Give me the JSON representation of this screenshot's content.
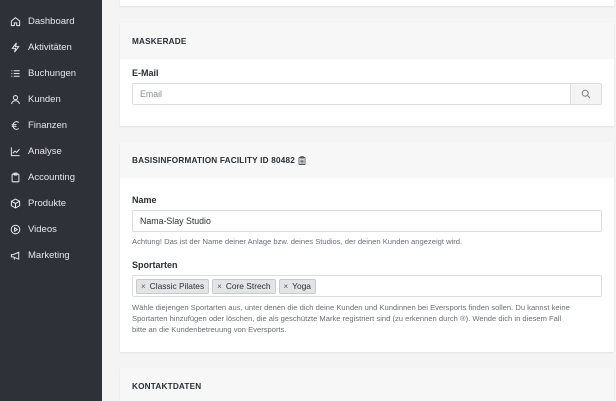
{
  "sidebar": {
    "items": [
      {
        "label": "Dashboard",
        "icon": "home-icon"
      },
      {
        "label": "Aktivitäten",
        "icon": "lightning-icon"
      },
      {
        "label": "Buchungen",
        "icon": "list-icon"
      },
      {
        "label": "Kunden",
        "icon": "user-icon"
      },
      {
        "label": "Finanzen",
        "icon": "euro-icon"
      },
      {
        "label": "Analyse",
        "icon": "chart-icon"
      },
      {
        "label": "Accounting",
        "icon": "clipboard-icon"
      },
      {
        "label": "Produkte",
        "icon": "box-icon"
      },
      {
        "label": "Videos",
        "icon": "play-circle-icon"
      },
      {
        "label": "Marketing",
        "icon": "megaphone-icon"
      }
    ]
  },
  "maskerade": {
    "title": "MASKERADE",
    "email_label": "E-Mail",
    "email_placeholder": "Email"
  },
  "basis": {
    "title": "BASISINFORMATION FACILITY ID 80482",
    "name_label": "Name",
    "name_value": "Nama-Slay Studio",
    "name_help": "Achtung! Das ist der Name deiner Anlage bzw. deines Studios, der deinen Kunden angezeigt wird.",
    "sport_label": "Sportarten",
    "sports": [
      "Classic Pilates",
      "Core Strech",
      "Yoga"
    ],
    "sport_help_1": "Wähle diejengen Sportarten aus, unter denen die dich deine Kunden und Kundinnen bei Eversports finden sollen. Du kannst keine",
    "sport_help_2": "Sportarten hinzufügen oder löschen, die als geschützte Marke registriert sind (zu erkennen durch ®). Wende dich in diesem Fall",
    "sport_help_3": "bitte an die Kundenbetreuung von Eversports."
  },
  "kontakt": {
    "title": "KONTAKTDATEN"
  },
  "colors": {
    "sidebar_bg": "#2e3138",
    "page_bg": "#f4f4f5"
  }
}
